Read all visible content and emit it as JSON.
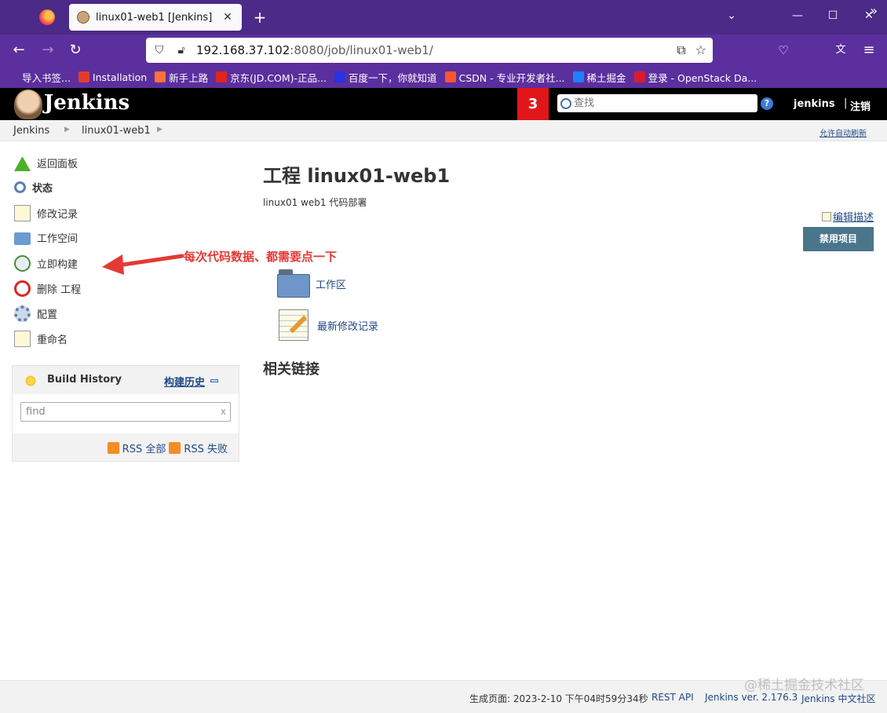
{
  "browser": {
    "tab_title": "linux01-web1 [Jenkins]",
    "url_host": "192.168.37.102",
    "url_path": ":8080/job/linux01-web1/",
    "bookmarks": [
      {
        "label": "导入书签...",
        "icon": "import-icon",
        "color": "#5b2f9e"
      },
      {
        "label": "Installation",
        "icon": "z-icon",
        "color": "#e33b2e"
      },
      {
        "label": "新手上路",
        "icon": "firefox-icon",
        "color": "#ff7139"
      },
      {
        "label": "京东(JD.COM)-正品...",
        "icon": "jd-icon",
        "color": "#e1251b"
      },
      {
        "label": "百度一下，你就知道",
        "icon": "baidu-icon",
        "color": "#2932e1"
      },
      {
        "label": "CSDN - 专业开发者社...",
        "icon": "csdn-icon",
        "color": "#fc5531"
      },
      {
        "label": "稀土掘金",
        "icon": "juejin-icon",
        "color": "#1e80ff"
      },
      {
        "label": "登录 - OpenStack Da...",
        "icon": "openstack-icon",
        "color": "#da1a32"
      }
    ]
  },
  "jenkins": {
    "logo_text": "Jenkins",
    "notification_count": "3",
    "search_placeholder": "查找",
    "user": "jenkins",
    "separator": "|",
    "logout": "注销"
  },
  "breadcrumb": {
    "items": [
      "Jenkins",
      "linux01-web1"
    ],
    "auto_refresh": "允许自动刷新"
  },
  "side_tasks": [
    {
      "label": "返回面板",
      "icon": "up-arrow-icon"
    },
    {
      "label": "状态",
      "icon": "search-icon"
    },
    {
      "label": "修改记录",
      "icon": "notepad-icon"
    },
    {
      "label": "工作空间",
      "icon": "folder-icon"
    },
    {
      "label": "立即构建",
      "icon": "clock-icon"
    },
    {
      "label": "删除 工程",
      "icon": "no-entry-icon"
    },
    {
      "label": "配置",
      "icon": "gear-icon"
    },
    {
      "label": "重命名",
      "icon": "notepad-icon"
    }
  ],
  "annotation": "每次代码数据、都需要点一下",
  "build_history": {
    "title": "Build History",
    "link": "构建历史",
    "search_placeholder": "find",
    "clear": "x",
    "rss_all": "RSS 全部",
    "rss_failed": "RSS 失败"
  },
  "main": {
    "title": "工程 linux01-web1",
    "description": "linux01 web1 代码部署",
    "edit_description": "编辑描述",
    "disable_button": "禁用项目",
    "links": [
      {
        "label": "工作区",
        "icon": "folder-icon"
      },
      {
        "label": "最新修改记录",
        "icon": "notepad-icon"
      }
    ],
    "related_links_title": "相关链接"
  },
  "footer": {
    "generated": "生成页面: 2023-2-10 下午04时59分34秒",
    "rest_api": "REST API",
    "version": "Jenkins ver. 2.176.3",
    "community": "Jenkins 中文社区"
  },
  "watermark": "@稀土掘金技术社区"
}
